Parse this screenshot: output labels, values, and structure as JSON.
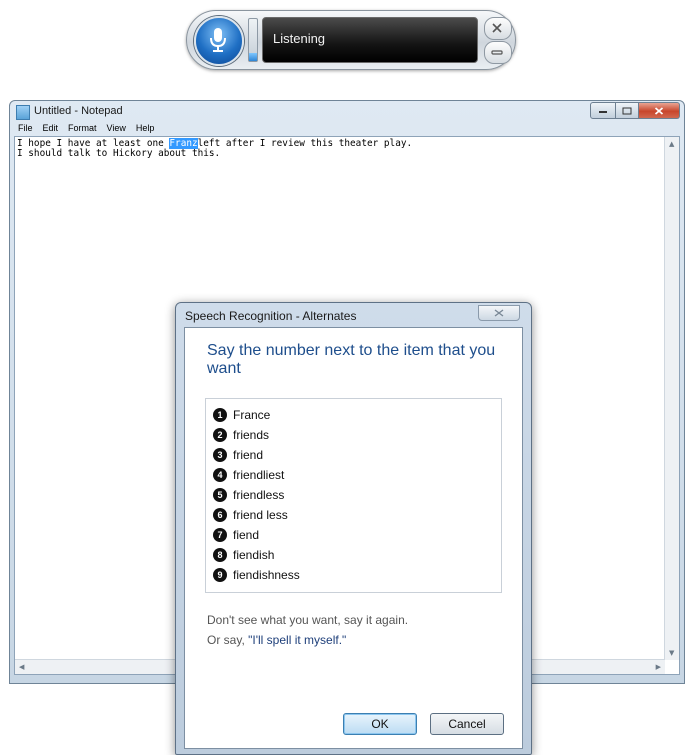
{
  "speech_bar": {
    "status": "Listening",
    "level_fraction": 0.2
  },
  "notepad": {
    "title": "Untitled - Notepad",
    "menu": [
      "File",
      "Edit",
      "Format",
      "View",
      "Help"
    ],
    "lines": {
      "line1_before": "I hope I have at least one ",
      "line1_selected": "Franz",
      "line1_after": "left after I review this theater play.",
      "line2": "I should talk to Hickory about this."
    }
  },
  "dialog": {
    "title": "Speech Recognition - Alternates",
    "heading": "Say the number next to the item that you want",
    "alternates": [
      {
        "number": "1",
        "text": "France"
      },
      {
        "number": "2",
        "text": "friends"
      },
      {
        "number": "3",
        "text": "friend"
      },
      {
        "number": "4",
        "text": "friendliest"
      },
      {
        "number": "5",
        "text": "friendless"
      },
      {
        "number": "6",
        "text": "friend less"
      },
      {
        "number": "7",
        "text": "fiend"
      },
      {
        "number": "8",
        "text": "fiendish"
      },
      {
        "number": "9",
        "text": "fiendishness"
      }
    ],
    "hint_line1": "Don't see what you want, say it again.",
    "hint_line2_prefix": "Or say, ",
    "hint_line2_quote": "\"I'll spell it myself.\"",
    "ok_label": "OK",
    "cancel_label": "Cancel"
  },
  "colors": {
    "heading": "#1e4e8c",
    "selection": "#3399ff",
    "mic_blue": "#1f6fc4"
  }
}
